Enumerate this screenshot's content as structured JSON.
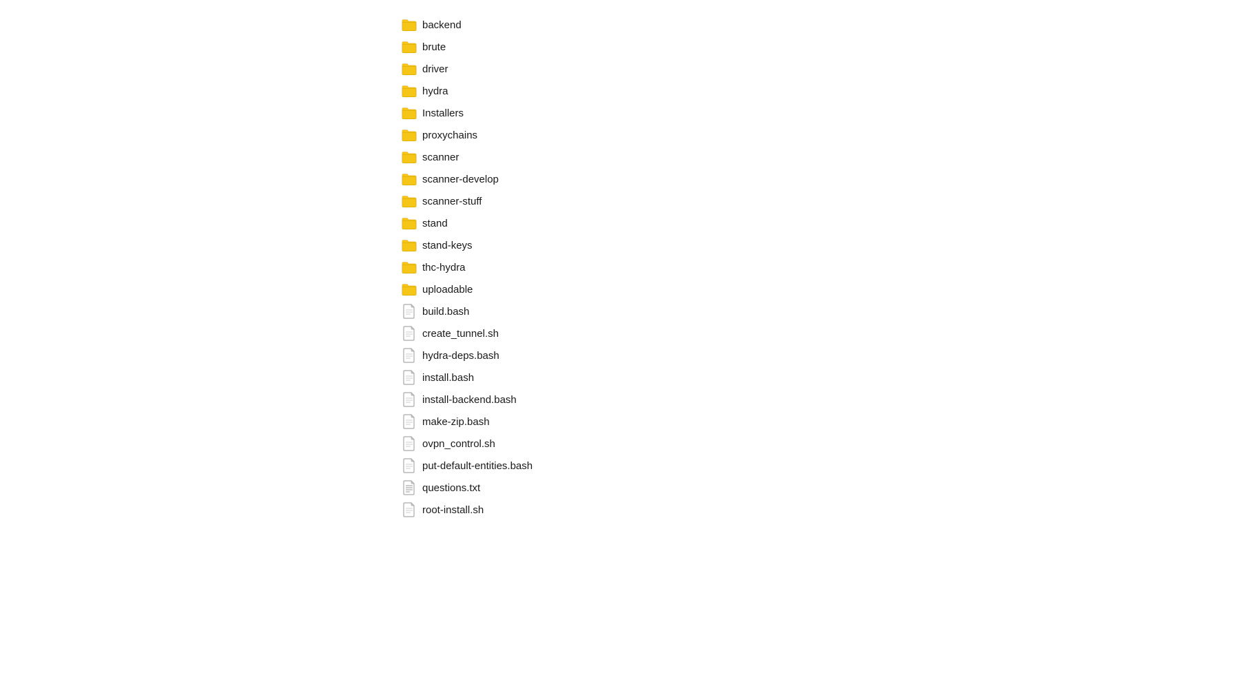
{
  "items": [
    {
      "name": "backend",
      "type": "folder"
    },
    {
      "name": "brute",
      "type": "folder"
    },
    {
      "name": "driver",
      "type": "folder"
    },
    {
      "name": "hydra",
      "type": "folder"
    },
    {
      "name": "Installers",
      "type": "folder"
    },
    {
      "name": "proxychains",
      "type": "folder"
    },
    {
      "name": "scanner",
      "type": "folder"
    },
    {
      "name": "scanner-develop",
      "type": "folder"
    },
    {
      "name": "scanner-stuff",
      "type": "folder"
    },
    {
      "name": "stand",
      "type": "folder"
    },
    {
      "name": "stand-keys",
      "type": "folder"
    },
    {
      "name": "thc-hydra",
      "type": "folder"
    },
    {
      "name": "uploadable",
      "type": "folder"
    },
    {
      "name": "build.bash",
      "type": "file"
    },
    {
      "name": "create_tunnel.sh",
      "type": "file"
    },
    {
      "name": "hydra-deps.bash",
      "type": "file"
    },
    {
      "name": "install.bash",
      "type": "file"
    },
    {
      "name": "install-backend.bash",
      "type": "file"
    },
    {
      "name": "make-zip.bash",
      "type": "file"
    },
    {
      "name": "ovpn_control.sh",
      "type": "file"
    },
    {
      "name": "put-default-entities.bash",
      "type": "file"
    },
    {
      "name": "questions.txt",
      "type": "file-lines"
    },
    {
      "name": "root-install.sh",
      "type": "file"
    }
  ],
  "colors": {
    "folder": "#F5C518",
    "folderDark": "#E0A800",
    "file": "#cccccc",
    "fileDark": "#999999"
  }
}
